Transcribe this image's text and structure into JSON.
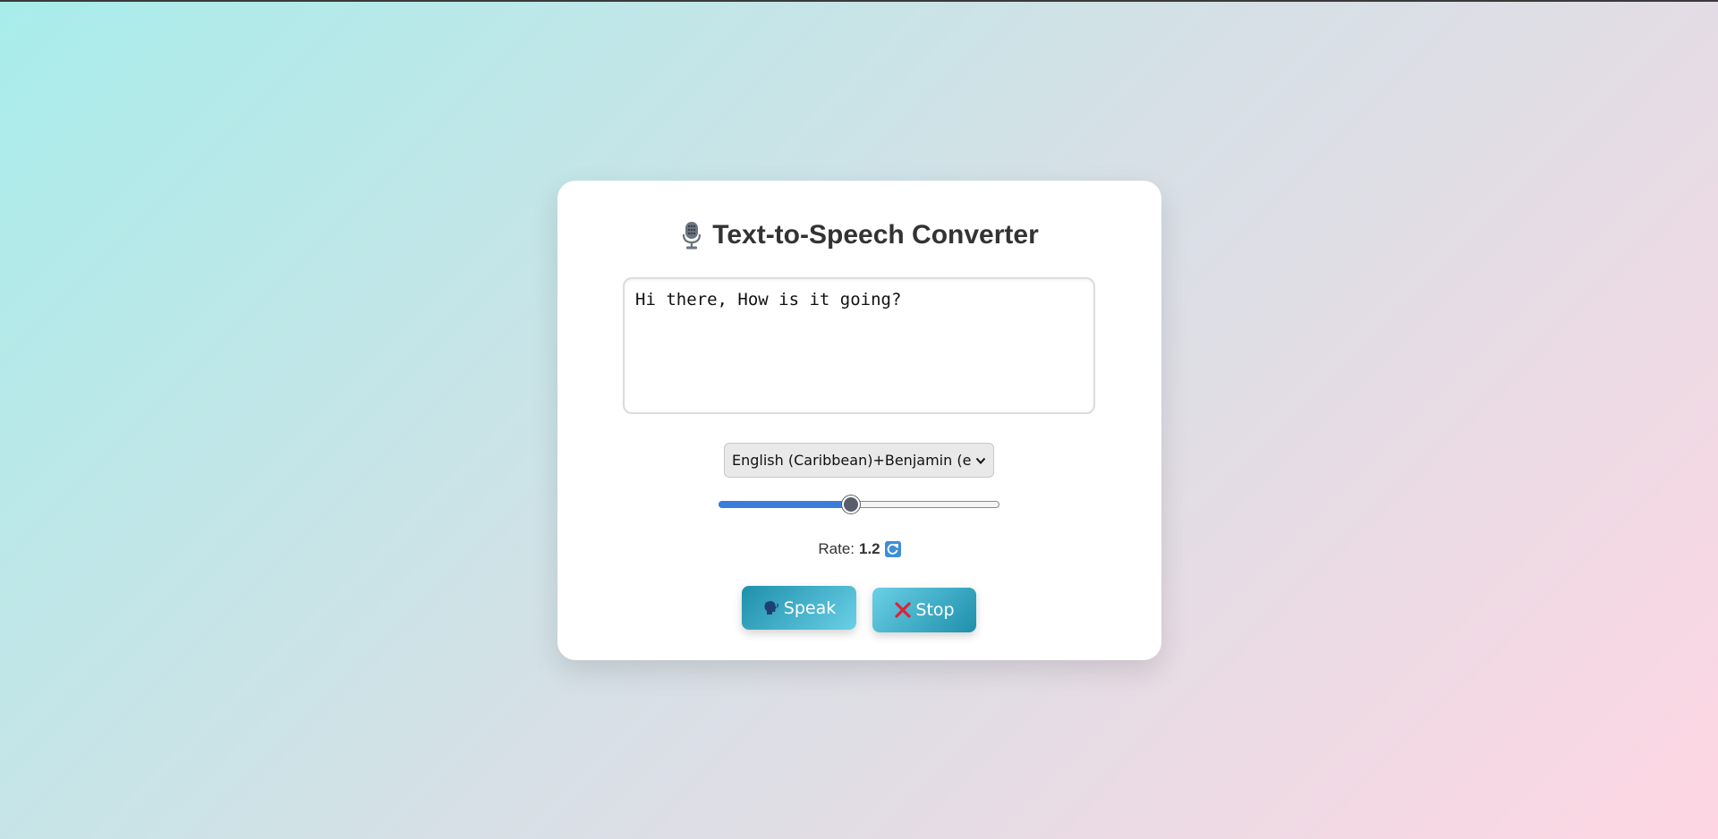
{
  "app": {
    "title": "Text-to-Speech Converter"
  },
  "text_input": {
    "value": "Hi there, How is it going?"
  },
  "voice_select": {
    "selected": "English (Caribbean)+Benjamin (en-"
  },
  "rate_slider": {
    "value": 1.2,
    "fraction": 0.47
  },
  "rate_display": {
    "label": "Rate:",
    "value": "1.2"
  },
  "buttons": {
    "speak_label": "Speak",
    "stop_label": "Stop"
  },
  "icons": {
    "title": "microphone-icon",
    "rate": "reload-icon",
    "speak": "speaking-head-icon",
    "stop": "cross-mark-icon"
  },
  "colors": {
    "accent": "#3b7ddd",
    "button": "#1e8fab",
    "stop_icon": "#e0213a"
  }
}
